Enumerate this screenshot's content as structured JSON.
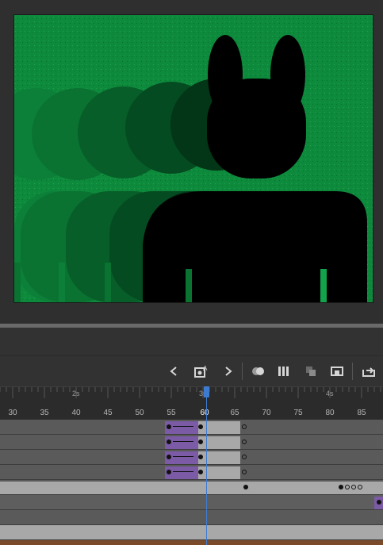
{
  "timeline": {
    "ruler_numbers": [
      "30",
      "35",
      "40",
      "45",
      "50",
      "55",
      "60",
      "65",
      "70",
      "75",
      "80",
      "85"
    ],
    "second_marks": [
      "2s",
      "3s",
      "4s"
    ],
    "current_frame": "60"
  },
  "toolbar": {
    "icons": [
      "chevron-left-icon",
      "insert-keyframe-icon",
      "chevron-right-icon",
      "onion-skin-icon",
      "edit-multiple-frames-icon",
      "center-frame-icon",
      "loop-icon",
      "export-icon"
    ]
  },
  "colors": {
    "stage_green": "#0f8a3e",
    "tween_purple": "#7b5aa6",
    "playhead": "#3d7bd0"
  }
}
